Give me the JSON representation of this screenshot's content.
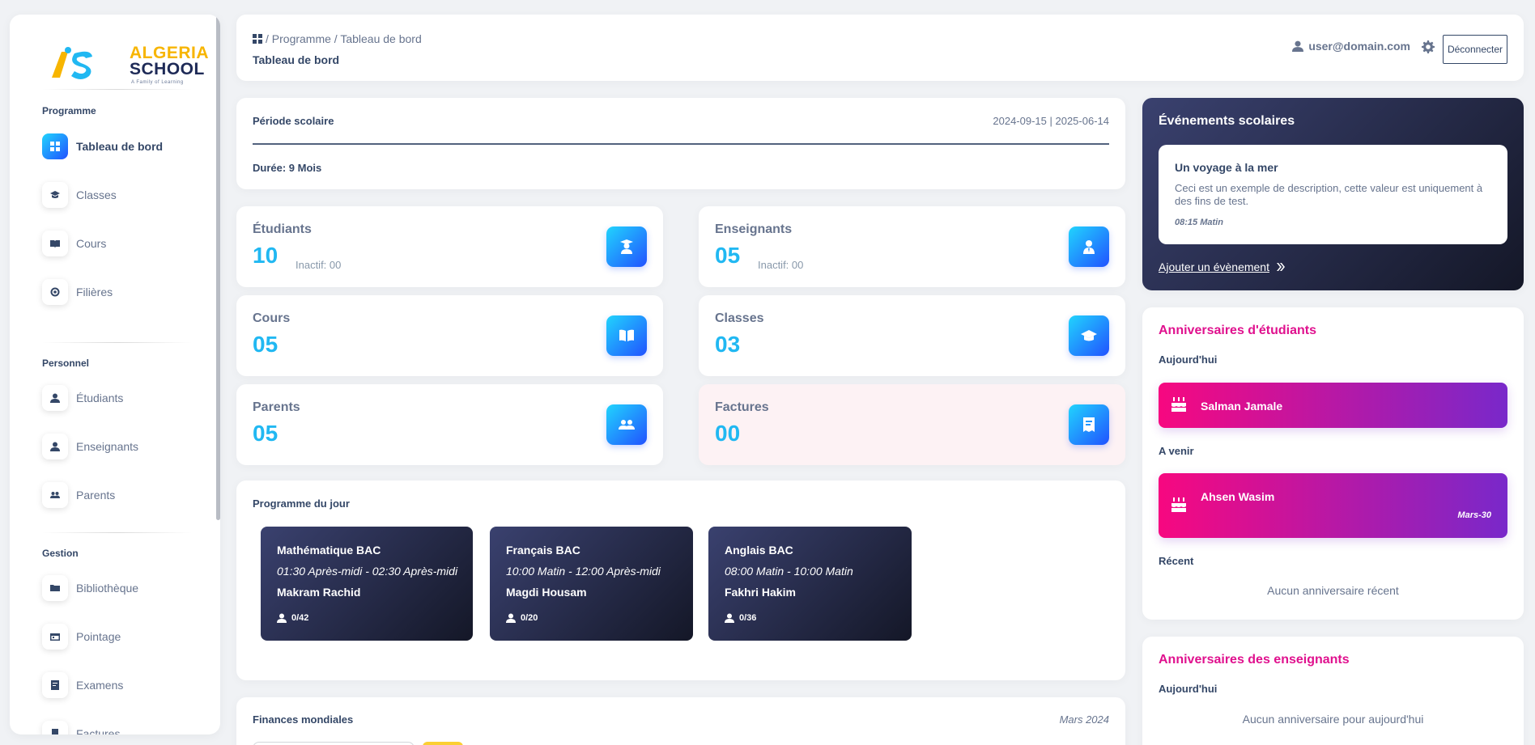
{
  "sidebar": {
    "logo": {
      "brand_top": "ALGERIA",
      "brand_bottom": "SCHOOL",
      "tagline": "A Family of Learning"
    },
    "sections": [
      "Programme",
      "Personnel",
      "Gestion"
    ],
    "items": [
      {
        "label": "Tableau de bord",
        "icon": "dashboard-icon"
      },
      {
        "label": "Classes",
        "icon": "graduation-cap-icon"
      },
      {
        "label": "Cours",
        "icon": "book-icon"
      },
      {
        "label": "Filières",
        "icon": "target-icon"
      },
      {
        "label": "Étudiants",
        "icon": "user-icon"
      },
      {
        "label": "Enseignants",
        "icon": "teacher-icon"
      },
      {
        "label": "Parents",
        "icon": "users-icon"
      },
      {
        "label": "Bibliothèque",
        "icon": "folder-icon"
      },
      {
        "label": "Pointage",
        "icon": "calendar-icon"
      },
      {
        "label": "Examens",
        "icon": "exam-icon"
      },
      {
        "label": "Factures",
        "icon": "invoice-icon"
      }
    ]
  },
  "header": {
    "breadcrumb": "/ Programme / Tableau de bord",
    "title": "Tableau de bord",
    "user": "user@domain.com",
    "logout_label": "Déconnecter"
  },
  "period": {
    "label": "Période scolaire",
    "dates": "2024-09-15 | 2025-06-14",
    "duration": "Durée: 9 Mois"
  },
  "stats": {
    "students": {
      "title": "Étudiants",
      "value": "10",
      "sub": "Inactif: 00"
    },
    "teachers": {
      "title": "Enseignants",
      "value": "05",
      "sub": "Inactif: 00"
    },
    "courses": {
      "title": "Cours",
      "value": "05"
    },
    "classes": {
      "title": "Classes",
      "value": "03"
    },
    "parents": {
      "title": "Parents",
      "value": "05"
    },
    "invoices": {
      "title": "Factures",
      "value": "00"
    }
  },
  "program": {
    "title": "Programme du jour",
    "courses": [
      {
        "name": "Mathématique BAC",
        "time": "01:30 Après-midi - 02:30 Après-midi",
        "teacher": "Makram Rachid",
        "count": "0/42"
      },
      {
        "name": "Français BAC",
        "time": "10:00 Matin - 12:00 Après-midi",
        "teacher": "Magdi Housam",
        "count": "0/20"
      },
      {
        "name": "Anglais BAC",
        "time": "08:00 Matin - 10:00 Matin",
        "teacher": "Fakhri Hakim",
        "count": "0/36"
      }
    ]
  },
  "finances": {
    "title": "Finances mondiales",
    "date": "Mars 2024"
  },
  "events": {
    "title": "Événements scolaires",
    "item": {
      "title": "Un voyage à la mer",
      "description": "Ceci est un exemple de description, cette valeur est uniquement à des fins de test.",
      "time": "08:15 Matin"
    },
    "add_link": "Ajouter un évènement"
  },
  "student_birthdays": {
    "title": "Anniversaires d'étudiants",
    "today_label": "Aujourd'hui",
    "today": [
      {
        "name": "Salman Jamale"
      }
    ],
    "upcoming_label": "A venir",
    "upcoming": [
      {
        "name": "Ahsen Wasim",
        "date": "Mars-30"
      }
    ],
    "recent_label": "Récent",
    "recent_empty": "Aucun anniversaire récent"
  },
  "teacher_birthdays": {
    "title": "Anniversaires des enseignants",
    "today_label": "Aujourd'hui",
    "today_empty": "Aucun anniversaire pour aujourd'hui"
  }
}
